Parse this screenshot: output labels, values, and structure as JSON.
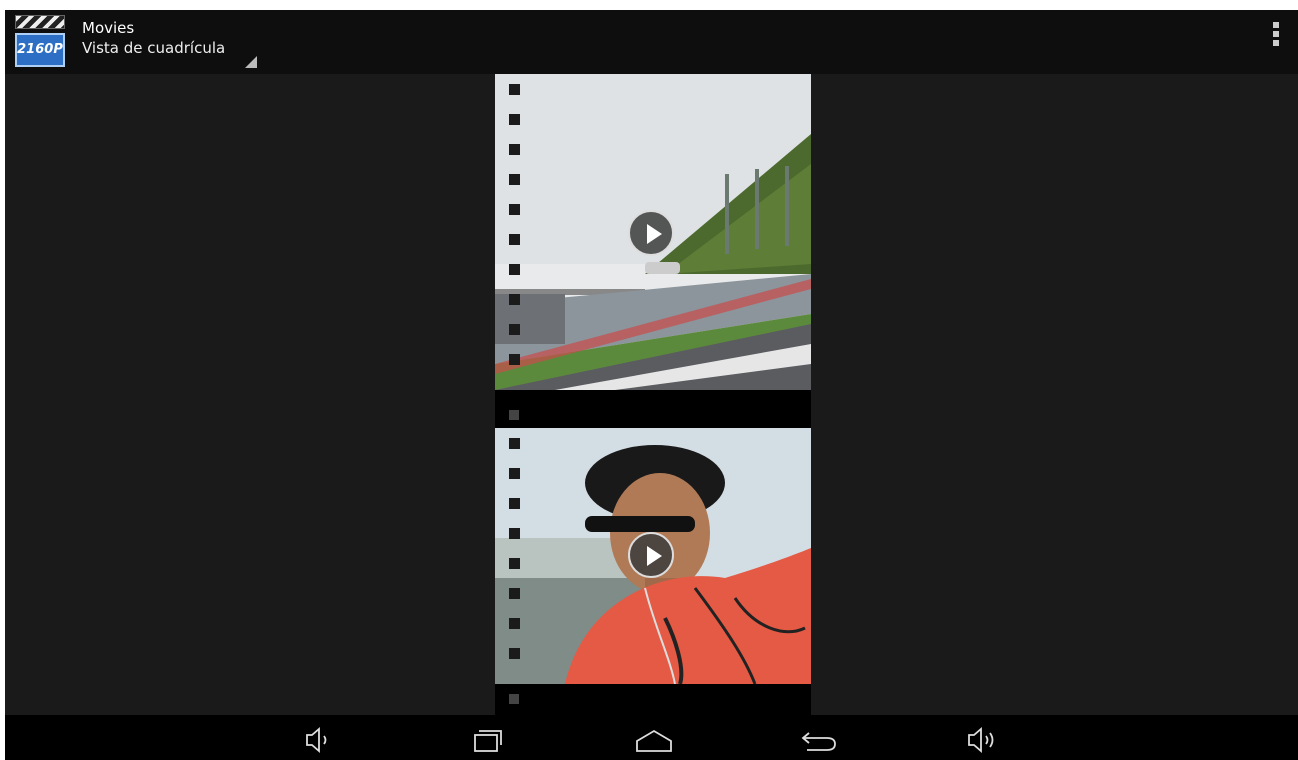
{
  "action_bar": {
    "app_icon_text": "2160P",
    "title": "Movies",
    "view_mode": "Vista de cuadrícula",
    "menu_icon": "overflow-menu-icon"
  },
  "videos": [
    {
      "thumbnail": "race-track-scene",
      "play_icon": "play-icon"
    },
    {
      "thumbnail": "man-in-red-shirt",
      "play_icon": "play-icon"
    }
  ],
  "navigation_bar": {
    "buttons": [
      "volume-down-icon",
      "recent-apps-icon",
      "home-icon",
      "back-icon",
      "volume-up-icon"
    ]
  }
}
